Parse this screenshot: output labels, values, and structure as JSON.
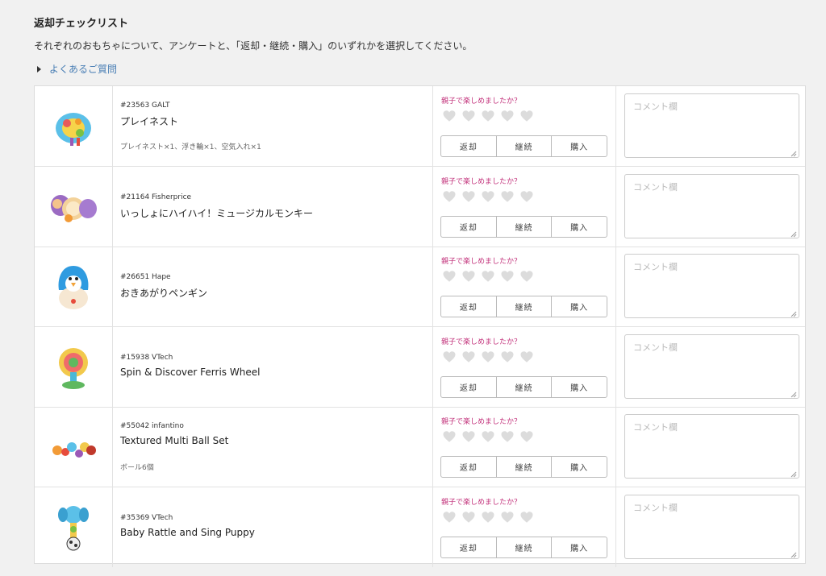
{
  "page": {
    "title": "返却チェックリスト",
    "description": "それぞれのおもちゃについて、アンケートと、「返却・継続・購入」のいずれかを選択してください。",
    "faq_label": "よくあるご質問"
  },
  "survey": {
    "question": "親子で楽しめましたか？",
    "rating_max": 5,
    "buttons": [
      "返却",
      "継続",
      "購入"
    ],
    "comment_placeholder": "コメント欄"
  },
  "colors": {
    "background": "#f1f1f1",
    "question": "#c2307a",
    "link": "#4a7fb5",
    "heart": "#dcdcdc"
  },
  "items": [
    {
      "code": "#23563 GALT",
      "name": "プレイネスト",
      "contents": "プレイネスト×1、浮き輪×1、空気入れ×1",
      "image": "playnest-icon"
    },
    {
      "code": "#21164 Fisherprice",
      "name": "いっしょにハイハイ！ミュージカルモンキー",
      "contents": "",
      "image": "monkey-toy-icon"
    },
    {
      "code": "#26651 Hape",
      "name": "おきあがりペンギン",
      "contents": "",
      "image": "penguin-toy-icon"
    },
    {
      "code": "#15938 VTech",
      "name": "Spin & Discover Ferris Wheel",
      "contents": "",
      "image": "ferris-wheel-toy-icon"
    },
    {
      "code": "#55042 infantino",
      "name": "Textured Multi Ball Set",
      "contents": "ボール6個",
      "image": "ball-set-icon"
    },
    {
      "code": "#35369 VTech",
      "name": "Baby Rattle and Sing Puppy",
      "contents": "",
      "image": "rattle-puppy-icon"
    }
  ]
}
